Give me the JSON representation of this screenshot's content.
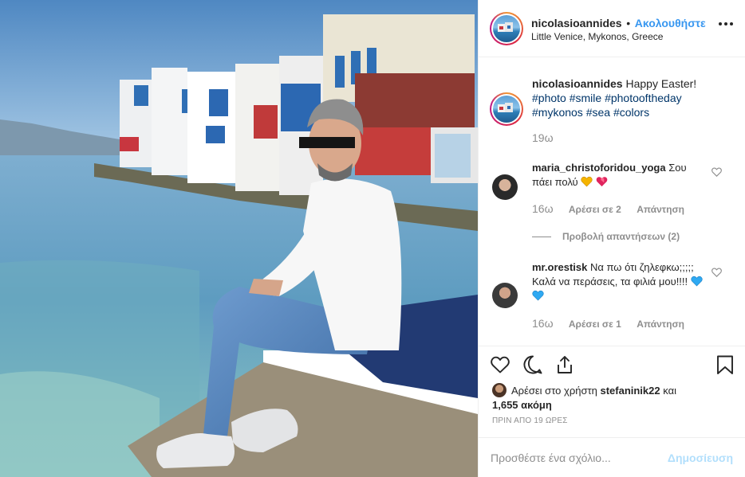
{
  "post": {
    "photo_alt": "",
    "header": {
      "username": "nicolasioannides",
      "separator": "•",
      "follow_label": "Ακολουθήστε",
      "location": "Little Venice, Mykonos, Greece"
    },
    "caption": {
      "username": "nicolasioannides",
      "text": "Happy Easter!",
      "hashtags": [
        "#photo",
        "#smile",
        "#photooftheday",
        "#mykonos",
        "#sea",
        "#colors"
      ],
      "time": "19ω"
    },
    "comments": [
      {
        "username": "maria_christoforidou_yoga",
        "text": "Σου πάει πολύ",
        "emoji": [
          "yellow-heart",
          "red-hearts"
        ],
        "time": "16ω",
        "likes_label": "Αρέσει σε 2",
        "reply_label": "Απάντηση",
        "view_replies_label": "Προβολή απαντήσεων (2)"
      },
      {
        "username": "mr.orestisk",
        "text": "Να πω ότι ζηλεφκω;;;;; Καλά να περάσεις, τα φιλιά μου!!!!",
        "emoji": [
          "blue-heart",
          "blue-heart"
        ],
        "time": "16ω",
        "likes_label": "Αρέσει σε 1",
        "reply_label": "Απάντηση"
      }
    ],
    "likes": {
      "prefix": "Αρέσει στο χρήστη",
      "user": "stefaninik22",
      "connector": "και",
      "others": "1,655 ακόμη"
    },
    "timestamp": "ΠΡΙΝ ΑΠΟ 19 ΩΡΕΣ",
    "comment_box": {
      "placeholder": "Προσθέστε ένα σχόλιο...",
      "post_label": "Δημοσίευση"
    },
    "icons": {
      "like": "heart-icon",
      "comment": "comment-icon",
      "share": "share-icon",
      "save": "bookmark-icon",
      "more": "more-options-icon"
    },
    "colors": {
      "link_blue": "#3897f0",
      "hashtag": "#003569",
      "muted": "#8e8e8e",
      "post_disabled": "#b2dffc"
    }
  }
}
